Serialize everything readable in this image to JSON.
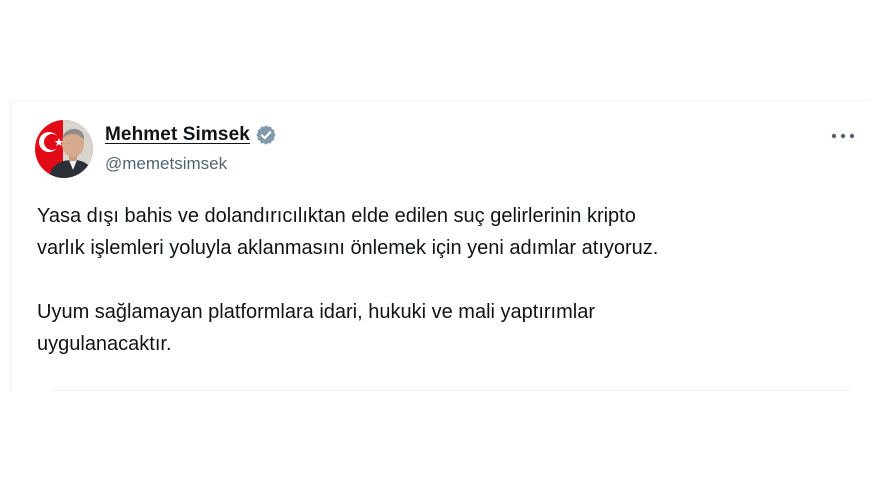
{
  "author": {
    "display_name": "Mehmet Simsek",
    "handle": "@memetsimsek",
    "verified": true,
    "verified_color": "#829aab"
  },
  "tweet": {
    "paragraphs": [
      "Yasa dışı bahis ve dolandırıcılıktan elde edilen suç gelirlerinin kripto\nvarlık işlemleri yoluyla aklanmasını önlemek için yeni adımlar atıyoruz.",
      "Uyum sağlamayan platformlara idari, hukuki ve mali yaptırımlar\nuygulanacaktır."
    ]
  },
  "icons": {
    "avatar": "avatar-photo",
    "badge": "verified-badge-icon",
    "more": "more-options-icon"
  },
  "colors": {
    "text": "#0f1419",
    "secondary_text": "#536471",
    "avatar_flag": "#e30a17"
  }
}
